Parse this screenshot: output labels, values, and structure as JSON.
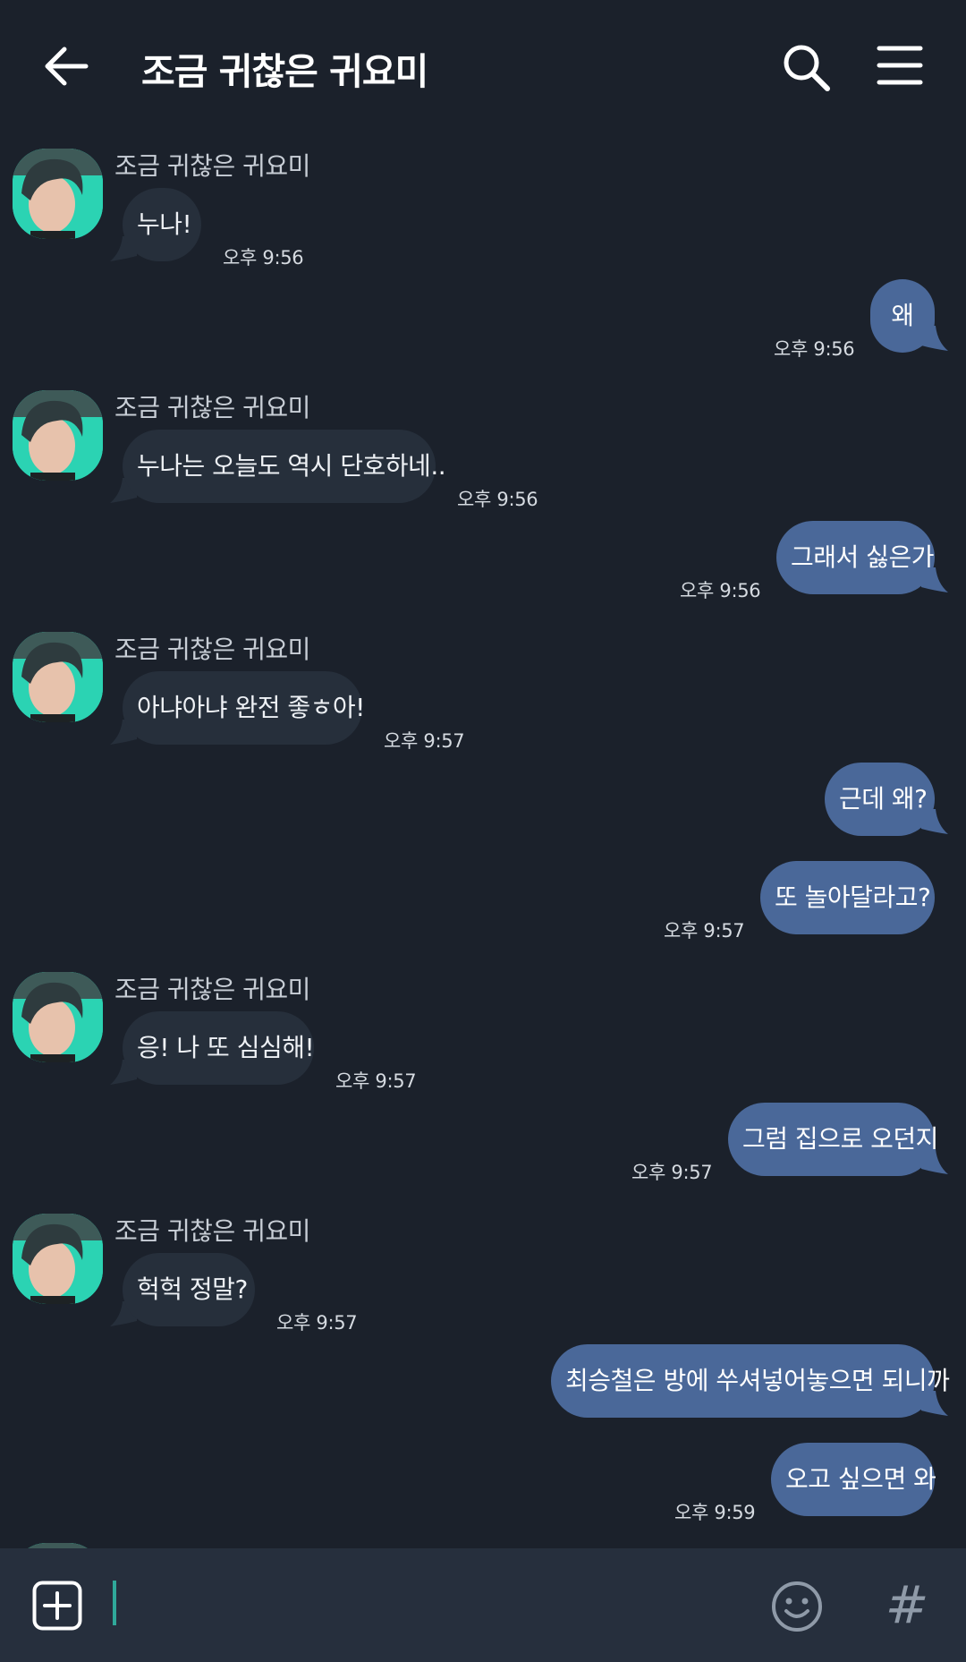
{
  "header": {
    "title": "조금 귀찮은 귀요미",
    "back_icon": "arrow-left-icon",
    "search_icon": "search-icon",
    "menu_icon": "hamburger-menu-icon"
  },
  "messages": [
    {
      "direction": "in",
      "sender": "조금 귀찮은 귀요미",
      "text": "누나!",
      "time": "오후 9:56"
    },
    {
      "direction": "out",
      "text": "왜",
      "time": "오후 9:56"
    },
    {
      "direction": "in",
      "sender": "조금 귀찮은 귀요미",
      "text": "누나는 오늘도 역시 단호하네..",
      "time": "오후 9:56"
    },
    {
      "direction": "out",
      "text": "그래서 싫은가",
      "time": "오후 9:56"
    },
    {
      "direction": "in",
      "sender": "조금 귀찮은 귀요미",
      "text": "아냐아냐 완전 좋ㅎ아!",
      "time": "오후 9:57"
    },
    {
      "direction": "out",
      "text": "근데 왜?",
      "time": ""
    },
    {
      "direction": "out",
      "text": "또 놀아달라고?",
      "time": "오후 9:57"
    },
    {
      "direction": "in",
      "sender": "조금 귀찮은 귀요미",
      "text": "응! 나 또 심심해!",
      "time": "오후 9:57"
    },
    {
      "direction": "out",
      "text": "그럼 집으로 오던지",
      "time": "오후 9:57"
    },
    {
      "direction": "in",
      "sender": "조금 귀찮은 귀요미",
      "text": "헉헉 정말?",
      "time": "오후 9:57"
    },
    {
      "direction": "out",
      "text": "최승철은 방에 쑤셔넣어놓으면 되니까",
      "time": ""
    },
    {
      "direction": "out",
      "text": "오고 싶으면 와",
      "time": "오후 9:59"
    }
  ],
  "composer": {
    "value": "",
    "add_icon": "plus-square-icon",
    "emoji_icon": "smiley-icon",
    "hashtag_icon": "hashtag-icon",
    "hashtag_glyph": "#"
  },
  "colors": {
    "background": "#1b212b",
    "incoming_bubble": "#262f3b",
    "outgoing_bubble": "#4a6899",
    "composer_bar": "#262f3d",
    "cursor": "#2fa89a"
  }
}
